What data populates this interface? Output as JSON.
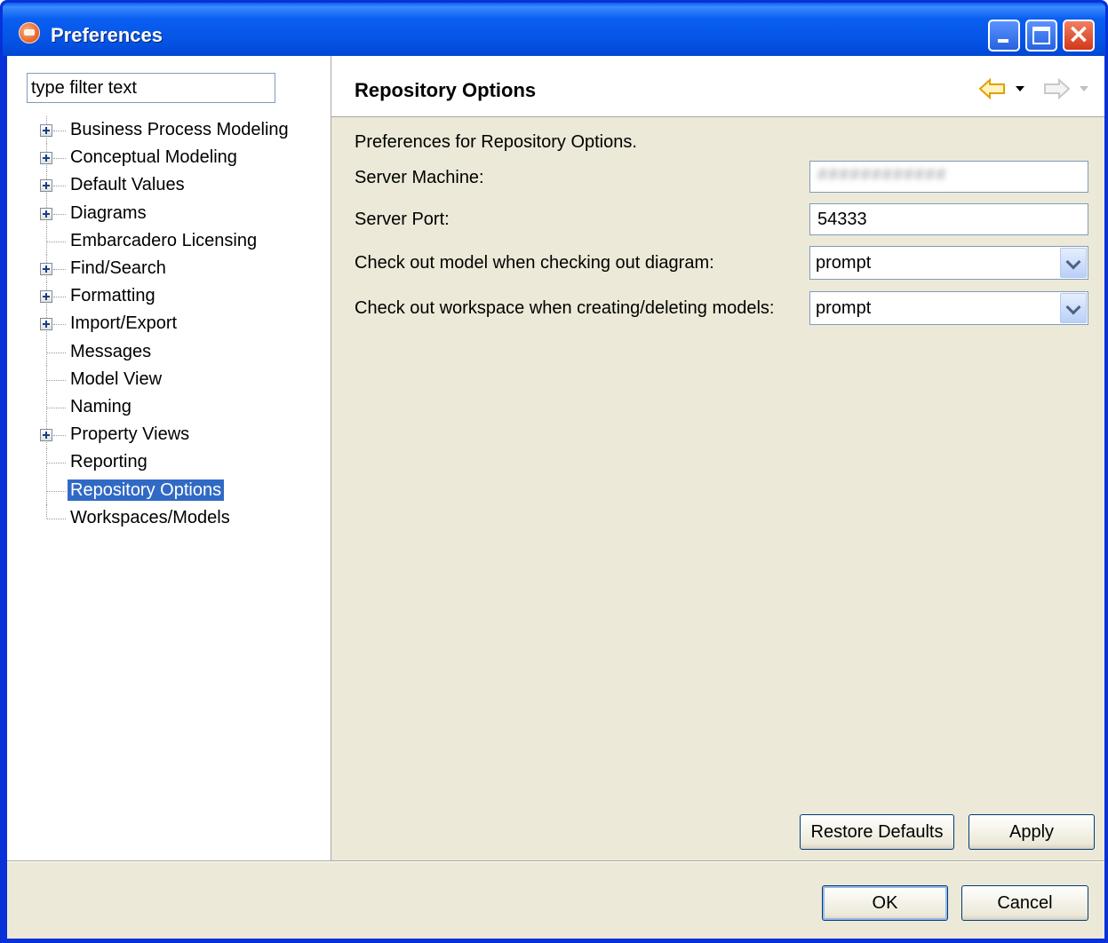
{
  "window": {
    "title": "Preferences"
  },
  "sidebar": {
    "filter_value": "type filter text",
    "items": [
      {
        "label": "Business Process Modeling",
        "expandable": true
      },
      {
        "label": "Conceptual Modeling",
        "expandable": true
      },
      {
        "label": "Default Values",
        "expandable": true
      },
      {
        "label": "Diagrams",
        "expandable": true
      },
      {
        "label": "Embarcadero Licensing",
        "expandable": false
      },
      {
        "label": "Find/Search",
        "expandable": true
      },
      {
        "label": "Formatting",
        "expandable": true
      },
      {
        "label": "Import/Export",
        "expandable": true
      },
      {
        "label": "Messages",
        "expandable": false
      },
      {
        "label": "Model View",
        "expandable": false
      },
      {
        "label": "Naming",
        "expandable": false
      },
      {
        "label": "Property Views",
        "expandable": true
      },
      {
        "label": "Reporting",
        "expandable": false
      },
      {
        "label": "Repository Options",
        "expandable": false,
        "selected": true
      },
      {
        "label": "Workspaces/Models",
        "expandable": false
      }
    ]
  },
  "page": {
    "title": "Repository Options",
    "description": "Preferences for Repository Options.",
    "server_machine_label": "Server Machine:",
    "server_machine_value": "############",
    "server_port_label": "Server Port:",
    "server_port_value": "54333",
    "checkout_model_label": "Check out model when checking out diagram:",
    "checkout_model_value": "prompt",
    "checkout_workspace_label": "Check out workspace when creating/deleting models:",
    "checkout_workspace_value": "prompt"
  },
  "buttons": {
    "restore_defaults": "Restore Defaults",
    "apply": "Apply",
    "ok": "OK",
    "cancel": "Cancel"
  },
  "colors": {
    "titlebar": "#0a5ff0",
    "selection": "#316ac5",
    "dialog_bg": "#ece9d8",
    "nav_arrow": "#f0b400"
  },
  "icons": {
    "app": "preferences-app-icon",
    "back": "back-arrow-icon",
    "forward": "forward-arrow-icon"
  }
}
